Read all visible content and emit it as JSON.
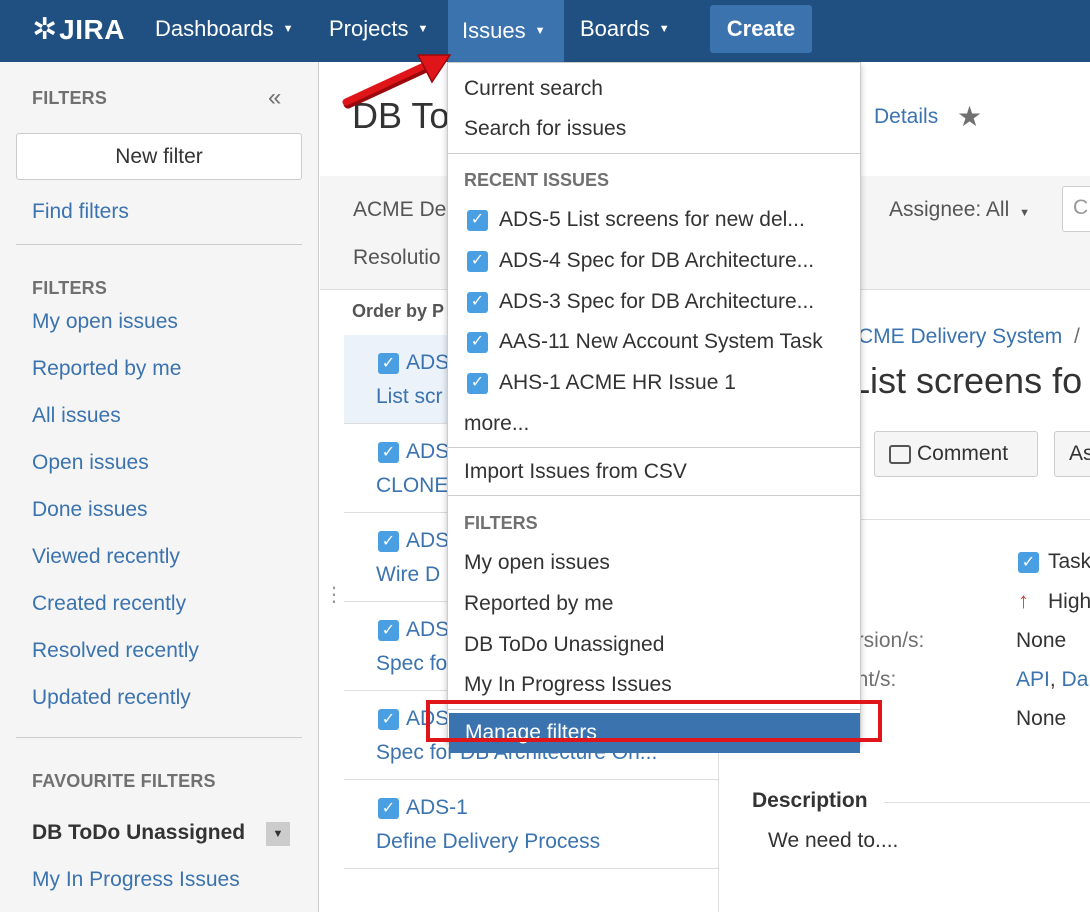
{
  "nav": {
    "logo": "JIRA",
    "items": [
      {
        "label": "Dashboards"
      },
      {
        "label": "Projects"
      },
      {
        "label": "Issues"
      },
      {
        "label": "Boards"
      }
    ],
    "create_label": "Create"
  },
  "sidebar": {
    "header": "FILTERS",
    "new_filter": "New filter",
    "find_filters": "Find filters",
    "filters_header": "FILTERS",
    "filters": [
      {
        "label": "My open issues"
      },
      {
        "label": "Reported by me"
      },
      {
        "label": "All issues"
      },
      {
        "label": "Open issues"
      },
      {
        "label": "Done issues"
      },
      {
        "label": "Viewed recently"
      },
      {
        "label": "Created recently"
      },
      {
        "label": "Resolved recently"
      },
      {
        "label": "Updated recently"
      }
    ],
    "favourites_header": "FAVOURITE FILTERS",
    "favourites": [
      {
        "label": "DB ToDo Unassigned"
      },
      {
        "label": "My In Progress Issues"
      }
    ]
  },
  "main": {
    "title": "DB To",
    "details": "Details",
    "filter_project": "ACME De",
    "filter_resolution": "Resolutio",
    "assignee": "Assignee: All",
    "search_placeholder": "C",
    "order_by": "Order by P",
    "issues": [
      {
        "key": "ADS",
        "summary": "List scr"
      },
      {
        "key": "ADS",
        "summary": "CLONE"
      },
      {
        "key": "ADS",
        "summary": "Wire D"
      },
      {
        "key": "ADS",
        "summary": "Spec fo"
      },
      {
        "key": "ADS",
        "summary": "Spec for DB Architecture On..."
      },
      {
        "key": "ADS-1",
        "summary": "Define Delivery Process"
      }
    ],
    "detail": {
      "breadcrumb": "CME Delivery System",
      "breadcrumb_sep": "/",
      "title": "List screens fo",
      "comment_btn": "Comment",
      "assign_btn": "As",
      "type_value": "Task",
      "priority_value": "High",
      "fix_label": "ersion/s:",
      "fix_value": "None",
      "component_label": "ent/s:",
      "component_values": [
        "API",
        "Da"
      ],
      "component_sep": ",",
      "labels_value": "None",
      "description_heading": "Description",
      "description_text": "We need to...."
    }
  },
  "dropdown": {
    "current_search": "Current search",
    "search_for_issues": "Search for issues",
    "recent_header": "RECENT ISSUES",
    "recent": [
      {
        "label": "ADS-5 List screens for new del..."
      },
      {
        "label": "ADS-4 Spec for DB Architecture..."
      },
      {
        "label": "ADS-3 Spec for DB Architecture..."
      },
      {
        "label": "AAS-11 New Account System Task"
      },
      {
        "label": "AHS-1 ACME HR Issue 1"
      }
    ],
    "more": "more...",
    "import_csv": "Import Issues from CSV",
    "filters_header": "FILTERS",
    "filters": [
      {
        "label": "My open issues"
      },
      {
        "label": "Reported by me"
      },
      {
        "label": "DB ToDo Unassigned"
      },
      {
        "label": "My In Progress Issues"
      }
    ],
    "manage_filters": "Manage filters"
  },
  "colors": {
    "nav_bg": "#205081",
    "accent": "#3b73af",
    "annotation_red": "#e0151a"
  }
}
